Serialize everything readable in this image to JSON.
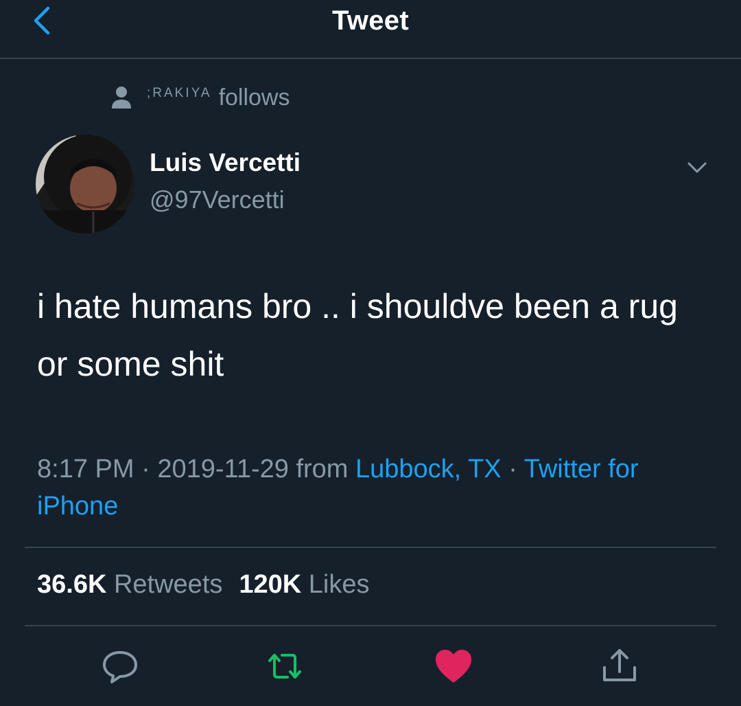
{
  "header": {
    "title": "Tweet",
    "back_icon": "chevron-left-icon",
    "accent": "#1da1f2"
  },
  "social_context": {
    "name": ";RAKIYA",
    "text": "follows",
    "icon": "person-icon"
  },
  "author": {
    "display_name": "Luis Vercetti",
    "handle": "@97Vercetti",
    "avatar": "avatar-photo",
    "menu_icon": "chevron-down-icon"
  },
  "tweet": {
    "text": "i hate humans bro .. i shouldve been a rug or some shit"
  },
  "meta": {
    "time": "8:17 PM",
    "separator": " · ",
    "date": "2019-11-29",
    "from_label": "from",
    "location": "Lubbock, TX",
    "source": "Twitter for iPhone"
  },
  "stats": {
    "retweets_count": "36.6K",
    "retweets_label": "Retweets",
    "likes_count": "120K",
    "likes_label": "Likes"
  },
  "actions": {
    "reply_icon": "reply-icon",
    "retweet_icon": "retweet-icon",
    "like_icon": "heart-icon",
    "share_icon": "share-icon",
    "retweet_color": "#17bf63",
    "like_color": "#e0245e"
  },
  "colors": {
    "background": "#15202b",
    "secondary_text": "#8899a6",
    "divider": "#38444d"
  }
}
